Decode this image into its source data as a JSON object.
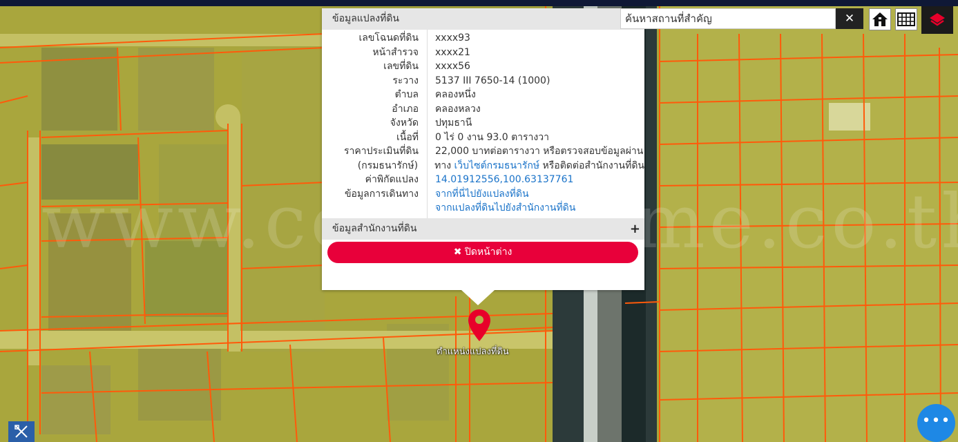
{
  "search": {
    "placeholder": "ค้นหาสถานที่สำคัญ",
    "clear_label": "✕"
  },
  "popup": {
    "title": "ข้อมูลแปลงที่ดิน",
    "rows": [
      {
        "label": "เลขโฉนดที่ดิน",
        "value": "xxxx93"
      },
      {
        "label": "หน้าสำรวจ",
        "value": "xxxx21"
      },
      {
        "label": "เลขที่ดิน",
        "value": "xxxx56"
      },
      {
        "label": "ระวาง",
        "value": "5137 III 7650-14 (1000)"
      },
      {
        "label": "ตำบล",
        "value": "คลองหนึ่ง"
      },
      {
        "label": "อำเภอ",
        "value": "คลองหลวง"
      },
      {
        "label": "จังหวัด",
        "value": "ปทุมธานี"
      },
      {
        "label": "เนื้อที่",
        "value": "0 ไร่ 0 งาน 93.0 ตารางวา"
      }
    ],
    "price": {
      "label_1": "ราคาประเมินที่ดิน",
      "label_2": "(กรมธนารักษ์)",
      "value_1": "22,000 บาทต่อตารางวา หรือตรวจสอบข้อมูลผ่าน",
      "value_2_prefix": "ทาง",
      "value_2_link": "เว็บไซต์กรมธนารักษ์",
      "value_2_suffix": "หรือติดต่อสำนักงานที่ดิน"
    },
    "coords": {
      "label": "ค่าพิกัดแปลง",
      "value": "14.01912556,100.63137761"
    },
    "directions": {
      "label": "ข้อมูลการเดินทาง",
      "link_1": "จากที่นี่ไปยังแปลงที่ดิน",
      "link_2": "จากแปลงที่ดินไปยังสำนักงานที่ดิน"
    },
    "office_section": "ข้อมูลสำนักงานที่ดิน",
    "office_expand": "+",
    "close_icon": "✖",
    "close_label": "ปิดหน้าต่าง"
  },
  "map": {
    "pin_label": "ตำแหน่งแปลงที่ดิน",
    "watermark": "www.centerhome.co.th",
    "parcel_line_color": "#ff5a0a",
    "pin_color": "#e8002a"
  },
  "icons": {
    "home": "home-icon",
    "grid": "grid-icon",
    "layers": "layers-icon",
    "tools": "tools-icon",
    "more": "more-icon"
  },
  "fab_label": "•••"
}
